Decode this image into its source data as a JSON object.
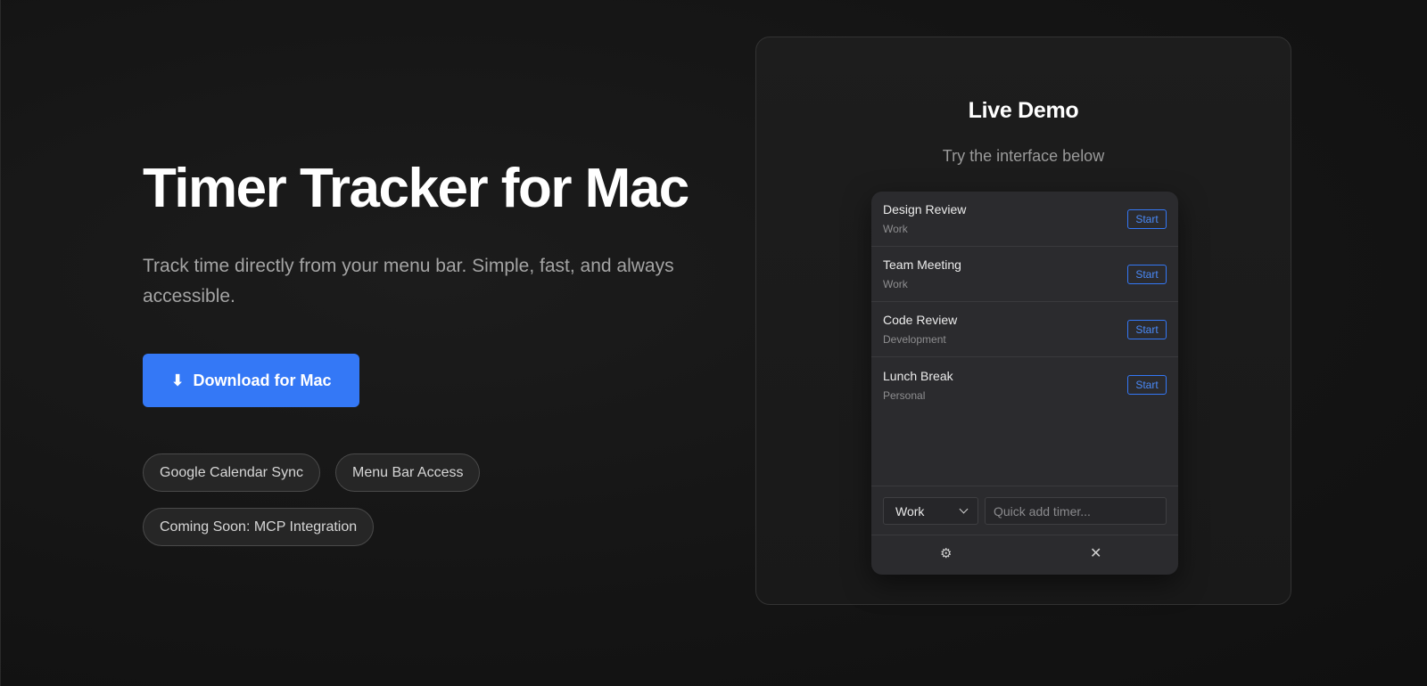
{
  "hero": {
    "title": "Timer Tracker for Mac",
    "subtitle": "Track time directly from your menu bar. Simple, fast, and always accessible.",
    "download_label": "Download for Mac",
    "download_icon": "⬇",
    "chips": [
      "Google Calendar Sync",
      "Menu Bar Access",
      "Coming Soon: MCP Integration"
    ]
  },
  "demo": {
    "title": "Live Demo",
    "subtitle": "Try the interface below",
    "timers": [
      {
        "name": "Design Review",
        "category": "Work",
        "action": "Start"
      },
      {
        "name": "Team Meeting",
        "category": "Work",
        "action": "Start"
      },
      {
        "name": "Code Review",
        "category": "Development",
        "action": "Start"
      },
      {
        "name": "Lunch Break",
        "category": "Personal",
        "action": "Start"
      }
    ],
    "category_select": "Work",
    "quick_add_placeholder": "Quick add timer...",
    "gear_icon": "⚙",
    "close_icon": "✕"
  },
  "colors": {
    "accent": "#3478f6",
    "background": "#141414",
    "card": "#1b1b1b",
    "panel": "#2b2b2e"
  }
}
